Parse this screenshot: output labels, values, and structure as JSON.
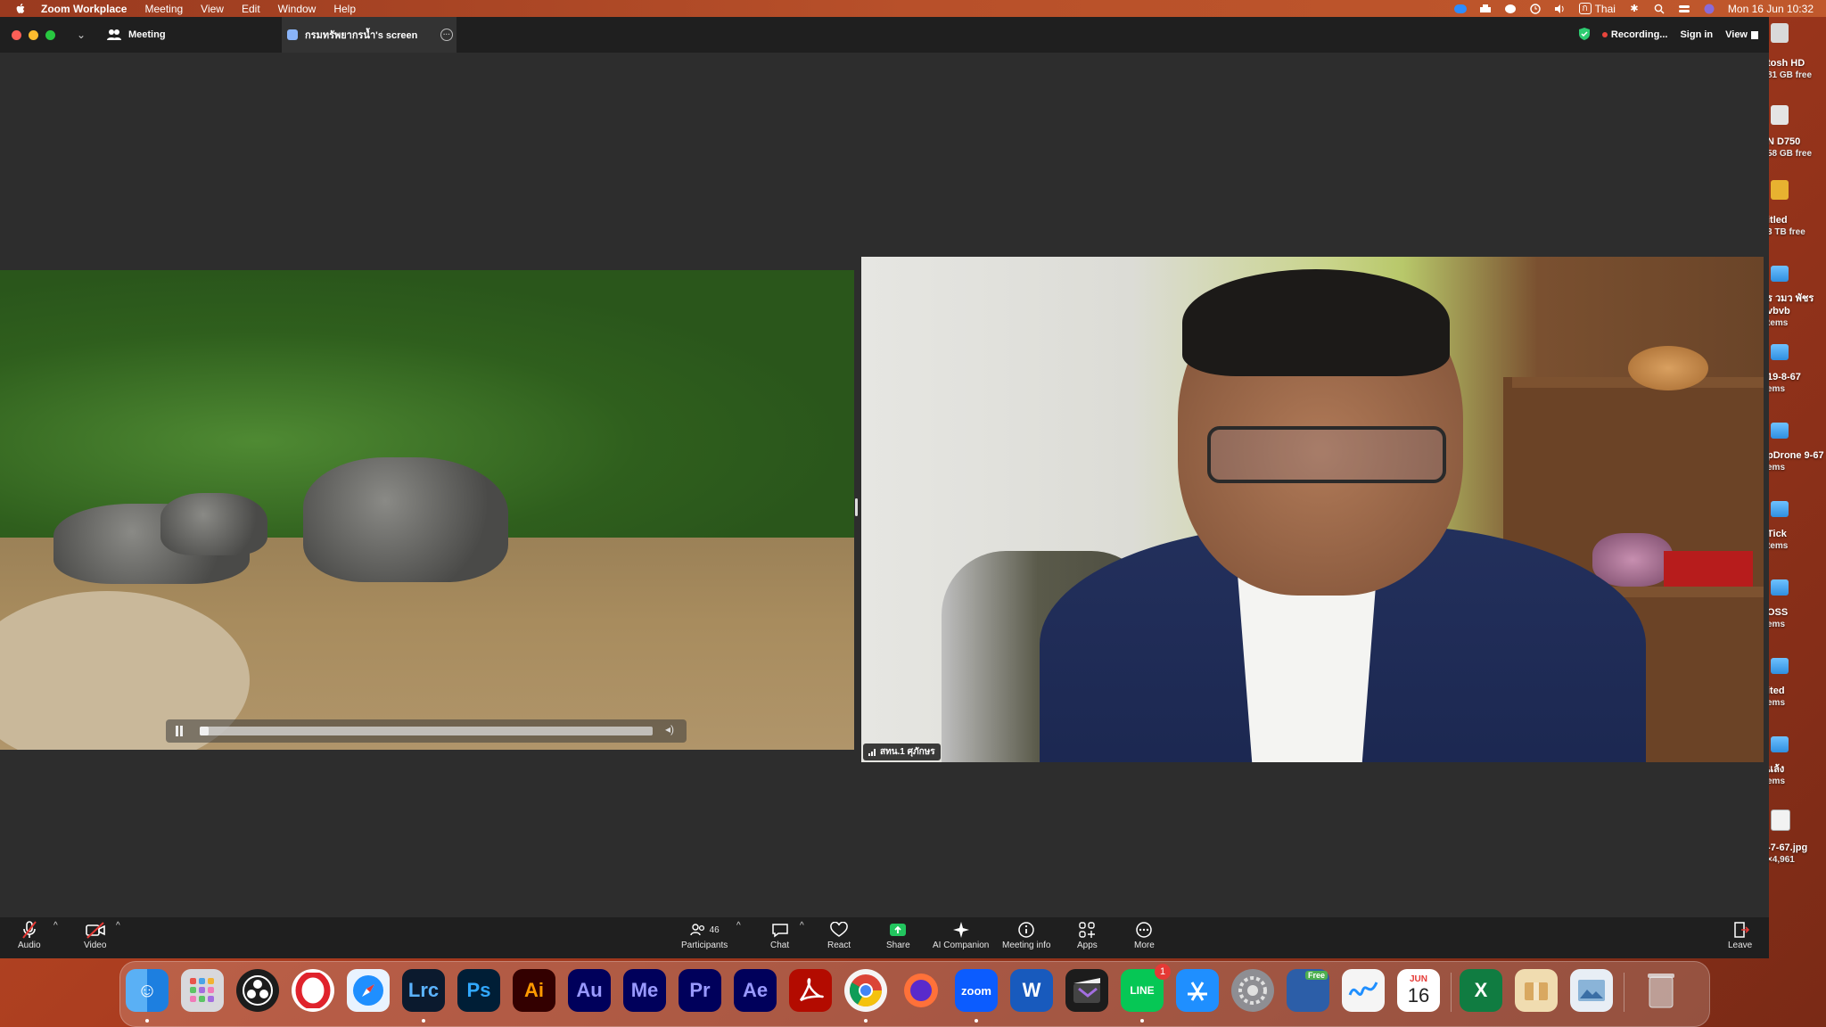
{
  "menubar": {
    "app_name": "Zoom Workplace",
    "menus": [
      "Meeting",
      "View",
      "Edit",
      "Window",
      "Help"
    ],
    "input_source": "Thai",
    "input_badge": "ก",
    "datetime": "Mon 16 Jun  10:32"
  },
  "desktop_items": [
    {
      "label": "tosh HD",
      "sub": "81 GB free"
    },
    {
      "label": "N D750",
      "sub": "58 GB free"
    },
    {
      "label": "itled",
      "sub": "3 TB free"
    },
    {
      "label": "ร วมว พัชร vbvb",
      "sub": "tems"
    },
    {
      "label": "19-8-67",
      "sub": "ems"
    },
    {
      "label": "pDrone 9-67",
      "sub": "ems"
    },
    {
      "label": "Tick",
      "sub": "tems"
    },
    {
      "label": "OSS",
      "sub": "ems"
    },
    {
      "label": "ited",
      "sub": "ems"
    },
    {
      "label": "แล้ง",
      "sub": "ems"
    },
    {
      "label": "-7-67.jpg",
      "sub": "×4,961"
    }
  ],
  "zoom": {
    "meeting_label": "Meeting",
    "share_tab": "กรมทรัพยากรน้ำ's screen",
    "recording": "Recording...",
    "sign_in": "Sign in",
    "view": "View",
    "speaker_name": "สทน.1 ศุภักษร",
    "video_progress": 0.02,
    "toolbar": {
      "audio": "Audio",
      "video": "Video",
      "participants": "Participants",
      "participants_count": "46",
      "chat": "Chat",
      "react": "React",
      "share": "Share",
      "ai_companion": "AI Companion",
      "meeting_info": "Meeting info",
      "apps": "Apps",
      "more": "More",
      "leave": "Leave"
    }
  },
  "dock": {
    "apps": [
      "Finder",
      "Launchpad",
      "OBS",
      "Opera",
      "Safari",
      "Lrc",
      "Ps",
      "Ai",
      "Au",
      "Me",
      "Pr",
      "Ae",
      "Acrobat",
      "Chrome",
      "Firefox",
      "zoom",
      "W",
      "Final Cut",
      "LINE",
      "App Store",
      "Settings",
      "Free",
      "Freeform",
      "Calendar",
      "X",
      "Archive",
      "Preview",
      "Trash"
    ],
    "lrc": "Lrc",
    "ps": "Ps",
    "ai": "Ai",
    "au": "Au",
    "me": "Me",
    "pr": "Pr",
    "ae": "Ae",
    "zoom": "zoom",
    "line": "LINE",
    "line_badge": "1",
    "free_label": "Free",
    "calendar_month": "JUN",
    "calendar_day": "16"
  }
}
